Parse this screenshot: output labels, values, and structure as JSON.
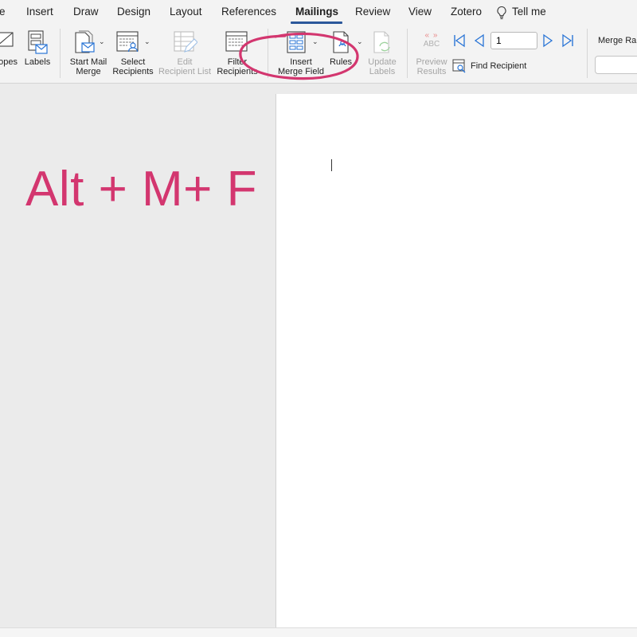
{
  "tabs": {
    "home_partial": "e",
    "insert": "Insert",
    "draw": "Draw",
    "design": "Design",
    "layout": "Layout",
    "references": "References",
    "mailings": "Mailings",
    "review": "Review",
    "view": "View",
    "zotero": "Zotero",
    "tell_me": "Tell me",
    "active_tab": "Mailings",
    "tell_me_icon": "lightbulb-icon"
  },
  "ribbon": {
    "create_group": {
      "envelopes_partial": "opes",
      "envelopes_icon": "envelope-icon",
      "labels": "Labels",
      "labels_icon": "labels-icon"
    },
    "start_group": {
      "start_mail_merge_line1": "Start Mail",
      "start_mail_merge_line2": "Merge",
      "start_mail_merge_icon": "document-mail-icon",
      "select_recipients_line1": "Select",
      "select_recipients_line2": "Recipients",
      "select_recipients_icon": "recipient-list-icon",
      "edit_recipient_list_line1": "Edit",
      "edit_recipient_list_line2": "Recipient List",
      "edit_recipient_list_icon": "edit-list-icon",
      "filter_recipients_line1": "Filter",
      "filter_recipients_line2": "Recipients",
      "filter_recipients_icon": "filter-list-icon"
    },
    "write_group": {
      "insert_merge_field_line1": "Insert",
      "insert_merge_field_line2": "Merge Field",
      "insert_merge_field_icon": "merge-field-icon",
      "rules": "Rules",
      "rules_icon": "rules-icon",
      "update_labels_line1": "Update",
      "update_labels_line2": "Labels",
      "update_labels_icon": "refresh-labels-icon"
    },
    "preview_group": {
      "preview_icon_text": "ABC",
      "preview_icon_chevrons": "« »",
      "preview_results_line1": "Preview",
      "preview_results_line2": "Results",
      "record_number": "1",
      "find_recipient": "Find Recipient",
      "find_recipient_icon": "find-recipient-icon",
      "first_record_icon": "first-record-icon",
      "previous_record_icon": "previous-record-icon",
      "next_record_icon": "next-record-icon",
      "last_record_icon": "last-record-icon"
    },
    "finish_group": {
      "merge_range_partial": "Merge Ran"
    }
  },
  "overlay": {
    "shortcut_text": "Alt + M+ F",
    "annotation": "circle-around-insert-merge-field-and-rules"
  },
  "colors": {
    "accent_tab_underline": "#2b579a",
    "annotation_pink": "#d3366f",
    "nav_arrow_blue": "#2a75d6",
    "preview_red": "#e88a8a"
  }
}
